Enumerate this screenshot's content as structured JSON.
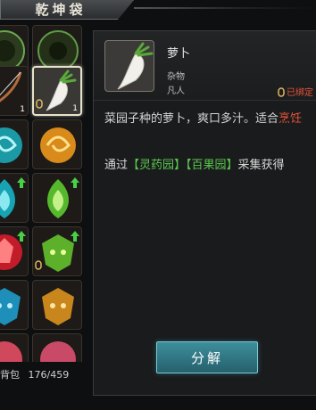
{
  "window": {
    "title": "乾坤袋"
  },
  "inventory": {
    "bag_label": "背包",
    "bag_count": "176/459",
    "slots": [
      {
        "count": "",
        "bound": false,
        "upgrade": false
      },
      {
        "count": "",
        "bound": false,
        "upgrade": false
      },
      {
        "count": "1",
        "bound": false,
        "upgrade": false
      },
      {
        "count": "1",
        "bound": true,
        "upgrade": false
      },
      {
        "count": "",
        "bound": false,
        "upgrade": false
      },
      {
        "count": "",
        "bound": false,
        "upgrade": false
      },
      {
        "count": "",
        "bound": false,
        "upgrade": true
      },
      {
        "count": "",
        "bound": false,
        "upgrade": true
      },
      {
        "count": "",
        "bound": false,
        "upgrade": true
      },
      {
        "count": "",
        "bound": true,
        "upgrade": true
      },
      {
        "count": "",
        "bound": false,
        "upgrade": false
      },
      {
        "count": "",
        "bound": false,
        "upgrade": false
      },
      {
        "count": "",
        "bound": false,
        "upgrade": false
      },
      {
        "count": "",
        "bound": false,
        "upgrade": false
      }
    ]
  },
  "item": {
    "name": "萝卜",
    "type": "杂物",
    "grade": "凡人",
    "bound_label": "已绑定",
    "desc_main": "菜园子种的萝卜，爽口多汁。适合",
    "desc_highlight": "烹饪",
    "source_prefix": "通过",
    "source_1": "【灵药园】",
    "source_2": "【百果园】",
    "source_suffix": "采集获得"
  },
  "actions": {
    "decompose_label": "分解"
  },
  "colors": {
    "accent_red": "#e8543a",
    "accent_green": "#59c84e",
    "button_teal": "#3e8e9c"
  },
  "icons": [
    "radish-icon",
    "bind-lock-icon",
    "upgrade-arrow-icon"
  ]
}
